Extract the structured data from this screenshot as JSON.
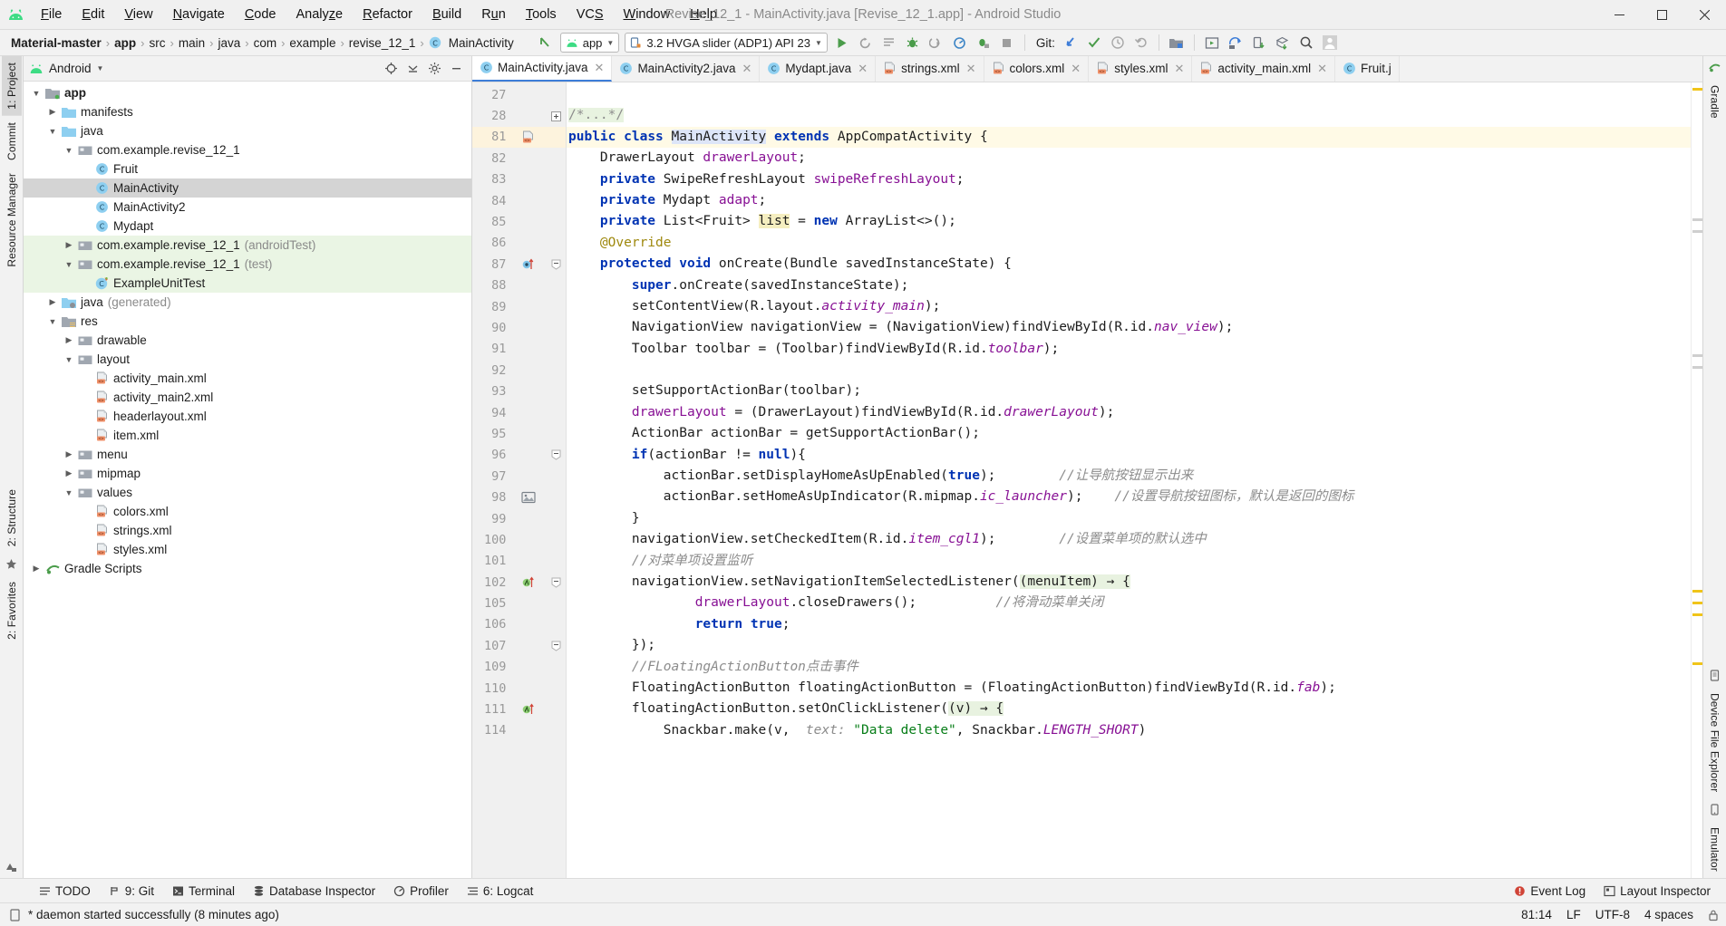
{
  "window": {
    "title": "Revise_12_1 - MainActivity.java [Revise_12_1.app] - Android Studio",
    "minimize_label": "–",
    "maximize_label": "❐",
    "close_label": "✕"
  },
  "menubar": {
    "items": [
      {
        "label": "File"
      },
      {
        "label": "Edit"
      },
      {
        "label": "View"
      },
      {
        "label": "Navigate"
      },
      {
        "label": "Code"
      },
      {
        "label": "Analyze"
      },
      {
        "label": "Refactor"
      },
      {
        "label": "Build"
      },
      {
        "label": "Run"
      },
      {
        "label": "Tools"
      },
      {
        "label": "VCS"
      },
      {
        "label": "Window"
      },
      {
        "label": "Help"
      }
    ]
  },
  "navbar": {
    "breadcrumbs": [
      {
        "label": "Material-master",
        "bold": true
      },
      {
        "label": "app",
        "bold": true
      },
      {
        "label": "src",
        "bold": false
      },
      {
        "label": "main",
        "bold": false
      },
      {
        "label": "java",
        "bold": false
      },
      {
        "label": "com",
        "bold": false
      },
      {
        "label": "example",
        "bold": false
      },
      {
        "label": "revise_12_1",
        "bold": false
      },
      {
        "label": "MainActivity",
        "bold": false
      }
    ],
    "separator": "›",
    "module_selector": "app",
    "device_selector": "3.2 HVGA slider (ADP1) API 23",
    "git_label": "Git:"
  },
  "left_rail": {
    "tabs": [
      "1: Project",
      "Commit",
      "Resource Manager",
      "2: Structure",
      "2: Favorites"
    ]
  },
  "right_rail": {
    "tabs": [
      "Gradle",
      "Device File Explorer",
      "Emulator"
    ]
  },
  "project": {
    "header_title": "Android",
    "tree": [
      {
        "indent": 0,
        "arrow": "down",
        "icon": "module-folder",
        "label": "app",
        "sub": "",
        "bold": true,
        "state": "normal"
      },
      {
        "indent": 1,
        "arrow": "right",
        "icon": "folder-blue",
        "label": "manifests",
        "sub": "",
        "bold": false,
        "state": "normal"
      },
      {
        "indent": 1,
        "arrow": "down",
        "icon": "folder-blue",
        "label": "java",
        "sub": "",
        "bold": false,
        "state": "normal"
      },
      {
        "indent": 2,
        "arrow": "down",
        "icon": "package",
        "label": "com.example.revise_12_1",
        "sub": "",
        "bold": false,
        "state": "normal"
      },
      {
        "indent": 3,
        "arrow": "none",
        "icon": "class",
        "label": "Fruit",
        "sub": "",
        "bold": false,
        "state": "normal"
      },
      {
        "indent": 3,
        "arrow": "none",
        "icon": "class",
        "label": "MainActivity",
        "sub": "",
        "bold": false,
        "state": "selected"
      },
      {
        "indent": 3,
        "arrow": "none",
        "icon": "class",
        "label": "MainActivity2",
        "sub": "",
        "bold": false,
        "state": "normal"
      },
      {
        "indent": 3,
        "arrow": "none",
        "icon": "class",
        "label": "Mydapt",
        "sub": "",
        "bold": false,
        "state": "normal"
      },
      {
        "indent": 2,
        "arrow": "right",
        "icon": "package",
        "label": "com.example.revise_12_1",
        "sub": "(androidTest)",
        "bold": false,
        "state": "test"
      },
      {
        "indent": 2,
        "arrow": "down",
        "icon": "package",
        "label": "com.example.revise_12_1",
        "sub": "(test)",
        "bold": false,
        "state": "test"
      },
      {
        "indent": 3,
        "arrow": "none",
        "icon": "class-test",
        "label": "ExampleUnitTest",
        "sub": "",
        "bold": false,
        "state": "test"
      },
      {
        "indent": 1,
        "arrow": "right",
        "icon": "folder-gen",
        "label": "java",
        "sub": "(generated)",
        "bold": false,
        "state": "normal"
      },
      {
        "indent": 1,
        "arrow": "down",
        "icon": "folder-res",
        "label": "res",
        "sub": "",
        "bold": false,
        "state": "normal"
      },
      {
        "indent": 2,
        "arrow": "right",
        "icon": "package",
        "label": "drawable",
        "sub": "",
        "bold": false,
        "state": "normal"
      },
      {
        "indent": 2,
        "arrow": "down",
        "icon": "package",
        "label": "layout",
        "sub": "",
        "bold": false,
        "state": "normal"
      },
      {
        "indent": 3,
        "arrow": "none",
        "icon": "xml-file",
        "label": "activity_main.xml",
        "sub": "",
        "bold": false,
        "state": "normal"
      },
      {
        "indent": 3,
        "arrow": "none",
        "icon": "xml-file",
        "label": "activity_main2.xml",
        "sub": "",
        "bold": false,
        "state": "normal"
      },
      {
        "indent": 3,
        "arrow": "none",
        "icon": "xml-file",
        "label": "headerlayout.xml",
        "sub": "",
        "bold": false,
        "state": "normal"
      },
      {
        "indent": 3,
        "arrow": "none",
        "icon": "xml-file",
        "label": "item.xml",
        "sub": "",
        "bold": false,
        "state": "normal"
      },
      {
        "indent": 2,
        "arrow": "right",
        "icon": "package",
        "label": "menu",
        "sub": "",
        "bold": false,
        "state": "normal"
      },
      {
        "indent": 2,
        "arrow": "right",
        "icon": "package",
        "label": "mipmap",
        "sub": "",
        "bold": false,
        "state": "normal"
      },
      {
        "indent": 2,
        "arrow": "down",
        "icon": "package",
        "label": "values",
        "sub": "",
        "bold": false,
        "state": "normal"
      },
      {
        "indent": 3,
        "arrow": "none",
        "icon": "xml-file",
        "label": "colors.xml",
        "sub": "",
        "bold": false,
        "state": "normal"
      },
      {
        "indent": 3,
        "arrow": "none",
        "icon": "xml-file",
        "label": "strings.xml",
        "sub": "",
        "bold": false,
        "state": "normal"
      },
      {
        "indent": 3,
        "arrow": "none",
        "icon": "xml-file",
        "label": "styles.xml",
        "sub": "",
        "bold": false,
        "state": "normal"
      },
      {
        "indent": 0,
        "arrow": "right",
        "icon": "gradle",
        "label": "Gradle Scripts",
        "sub": "",
        "bold": false,
        "state": "normal"
      }
    ]
  },
  "editor": {
    "tabs": [
      {
        "label": "MainActivity.java",
        "icon": "class",
        "active": true
      },
      {
        "label": "MainActivity2.java",
        "icon": "class",
        "active": false
      },
      {
        "label": "Mydapt.java",
        "icon": "class",
        "active": false
      },
      {
        "label": "strings.xml",
        "icon": "xml-file",
        "active": false
      },
      {
        "label": "colors.xml",
        "icon": "xml-file",
        "active": false
      },
      {
        "label": "styles.xml",
        "icon": "xml-file",
        "active": false
      },
      {
        "label": "activity_main.xml",
        "icon": "xml-file",
        "active": false
      },
      {
        "label": "Fruit.j",
        "icon": "class",
        "active": false
      }
    ],
    "lines": [
      {
        "num": "27",
        "mark": "",
        "fold": "",
        "highlight": false,
        "html": ""
      },
      {
        "num": "28",
        "mark": "",
        "fold": "plus",
        "highlight": false,
        "html": "<span class=\"foldbox\">/*...*/</span>"
      },
      {
        "num": "81",
        "mark": "xml",
        "fold": "",
        "highlight": true,
        "html": "<span class=\"k\">public</span> <span class=\"k\">class</span> <span class=\"sel-ident\">MainActivity</span> <span class=\"k\">extends</span> AppCompatActivity {"
      },
      {
        "num": "82",
        "mark": "",
        "fold": "",
        "highlight": false,
        "html": "    DrawerLayout <span class=\"fld\">drawerLayout</span>;"
      },
      {
        "num": "83",
        "mark": "",
        "fold": "",
        "highlight": false,
        "html": "    <span class=\"k\">private</span> SwipeRefreshLayout <span class=\"fld\">swipeRefreshLayout</span>;"
      },
      {
        "num": "84",
        "mark": "",
        "fold": "",
        "highlight": false,
        "html": "    <span class=\"k\">private</span> Mydapt <span class=\"fld\">adapt</span>;"
      },
      {
        "num": "85",
        "mark": "",
        "fold": "",
        "highlight": false,
        "html": "    <span class=\"k\">private</span> List&lt;Fruit&gt; <span class=\"sel-var\">list</span> = <span class=\"k\">new</span> ArrayList&lt;&gt;();"
      },
      {
        "num": "86",
        "mark": "",
        "fold": "",
        "highlight": false,
        "html": "    <span class=\"an\">@Override</span>"
      },
      {
        "num": "87",
        "mark": "override",
        "fold": "minus",
        "highlight": false,
        "html": "    <span class=\"k\">protected</span> <span class=\"k\">void</span> onCreate(Bundle savedInstanceState) {"
      },
      {
        "num": "88",
        "mark": "",
        "fold": "",
        "highlight": false,
        "html": "        <span class=\"k\">super</span>.onCreate(savedInstanceState);"
      },
      {
        "num": "89",
        "mark": "",
        "fold": "",
        "highlight": false,
        "html": "        setContentView(R.layout.<span class=\"itc\">activity_main</span>);"
      },
      {
        "num": "90",
        "mark": "",
        "fold": "",
        "highlight": false,
        "html": "        NavigationView navigationView = (NavigationView)findViewById(R.id.<span class=\"itc\">nav_view</span>);"
      },
      {
        "num": "91",
        "mark": "",
        "fold": "",
        "highlight": false,
        "html": "        Toolbar toolbar = (Toolbar)findViewById(R.id.<span class=\"itc\">toolbar</span>);"
      },
      {
        "num": "92",
        "mark": "",
        "fold": "",
        "highlight": false,
        "html": ""
      },
      {
        "num": "93",
        "mark": "",
        "fold": "",
        "highlight": false,
        "html": "        setSupportActionBar(toolbar);"
      },
      {
        "num": "94",
        "mark": "",
        "fold": "",
        "highlight": false,
        "html": "        <span class=\"fld\">drawerLayout</span> = (DrawerLayout)findViewById(R.id.<span class=\"itc\">drawerLayout</span>);"
      },
      {
        "num": "95",
        "mark": "",
        "fold": "",
        "highlight": false,
        "html": "        ActionBar actionBar = getSupportActionBar();"
      },
      {
        "num": "96",
        "mark": "",
        "fold": "minus",
        "highlight": false,
        "html": "        <span class=\"k\">if</span>(actionBar != <span class=\"k\">null</span>){"
      },
      {
        "num": "97",
        "mark": "",
        "fold": "",
        "highlight": false,
        "html": "            actionBar.setDisplayHomeAsUpEnabled(<span class=\"k\">true</span>);        <span class=\"cm\">//让导航按钮显示出来</span>"
      },
      {
        "num": "98",
        "mark": "image",
        "fold": "",
        "highlight": false,
        "html": "            actionBar.setHomeAsUpIndicator(R.mipmap.<span class=\"itc\">ic_launcher</span>);    <span class=\"cm\">//设置导航按钮图标，默认是返回的图标</span>"
      },
      {
        "num": "99",
        "mark": "",
        "fold": "",
        "highlight": false,
        "html": "        }"
      },
      {
        "num": "100",
        "mark": "",
        "fold": "",
        "highlight": false,
        "html": "        navigationView.setCheckedItem(R.id.<span class=\"itc\">item_cgl1</span>);        <span class=\"cm\">//设置菜单项的默认选中</span>"
      },
      {
        "num": "101",
        "mark": "",
        "fold": "",
        "highlight": false,
        "html": "        <span class=\"cm\">//对菜单项设置监听</span>"
      },
      {
        "num": "102",
        "mark": "lambda",
        "fold": "minus",
        "highlight": false,
        "html": "        navigationView.setNavigationItemSelectedListener(<span class=\"lam\">(menuItem) → {</span>"
      },
      {
        "num": "105",
        "mark": "",
        "fold": "",
        "highlight": false,
        "html": "                <span class=\"fld\">drawerLayout</span>.closeDrawers();          <span class=\"cm\">//将滑动菜单关闭</span>"
      },
      {
        "num": "106",
        "mark": "",
        "fold": "",
        "highlight": false,
        "html": "                <span class=\"k\">return</span> <span class=\"k\">true</span>;"
      },
      {
        "num": "107",
        "mark": "",
        "fold": "minus",
        "highlight": false,
        "html": "        });"
      },
      {
        "num": "109",
        "mark": "",
        "fold": "",
        "highlight": false,
        "html": "        <span class=\"cm\">//FLoatingActionButton点击事件</span>"
      },
      {
        "num": "110",
        "mark": "",
        "fold": "",
        "highlight": false,
        "html": "        FloatingActionButton floatingActionButton = (FloatingActionButton)findViewById(R.id.<span class=\"itc\">fab</span>);"
      },
      {
        "num": "111",
        "mark": "lambda",
        "fold": "",
        "highlight": false,
        "html": "        floatingActionButton.setOnClickListener(<span class=\"lam\">(v) → {</span>"
      },
      {
        "num": "114",
        "mark": "",
        "fold": "",
        "highlight": false,
        "html": "            Snackbar.make(v,  <span class=\"cm\">text:</span> <span class=\"st\">\"Data delete\"</span>, Snackbar.<span class=\"itc\">LENGTH_SHORT</span>)"
      }
    ]
  },
  "bottom_tools": {
    "items": [
      {
        "label": "TODO",
        "icon": "todo-icon"
      },
      {
        "label": "9: Git",
        "icon": "git-icon"
      },
      {
        "label": "Terminal",
        "icon": "terminal-icon"
      },
      {
        "label": "Database Inspector",
        "icon": "database-icon"
      },
      {
        "label": "Profiler",
        "icon": "profiler-icon"
      },
      {
        "label": "6: Logcat",
        "icon": "logcat-icon"
      }
    ],
    "right_items": [
      {
        "label": "Event Log",
        "icon": "event-log-icon"
      },
      {
        "label": "Layout Inspector",
        "icon": "layout-inspector-icon"
      }
    ]
  },
  "status": {
    "message": "* daemon started successfully (8 minutes ago)",
    "caret_position": "81:14",
    "line_separator": "LF",
    "encoding": "UTF-8",
    "indent": "4 spaces"
  },
  "colors": {
    "accent_blue": "#3d7dd8",
    "android_green": "#3ddc84",
    "selection_gray": "#d4d4d4",
    "test_green": "#eaf5e4",
    "highlight_yellow": "#fffae6"
  }
}
